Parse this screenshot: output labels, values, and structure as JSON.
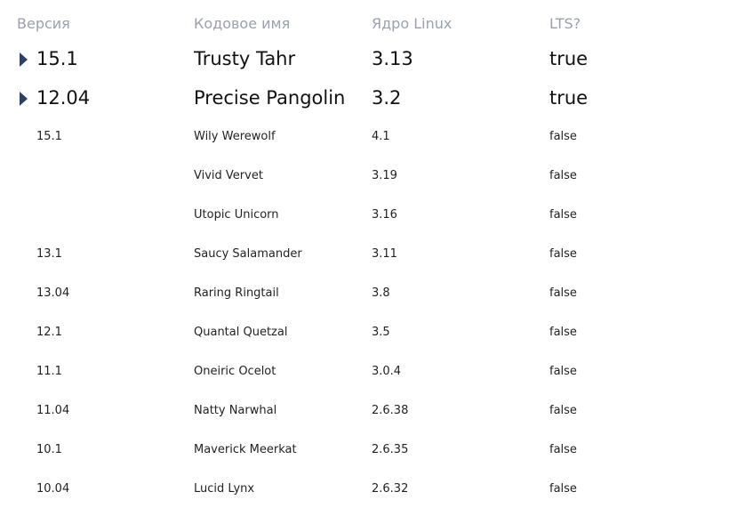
{
  "table": {
    "headers": {
      "version": "Версия",
      "codename": "Кодовое имя",
      "kernel": "Ядро Linux",
      "lts": "LTS?"
    },
    "groups": [
      {
        "version": "15.1",
        "codename": "Trusty Tahr",
        "kernel": "3.13",
        "lts": "true",
        "expand_icon": "triangle-right-icon"
      },
      {
        "version": "12.04",
        "codename": "Precise Pangolin",
        "kernel": "3.2",
        "lts": "true",
        "expand_icon": "triangle-right-icon"
      }
    ],
    "rows": [
      {
        "version": "15.1",
        "codename": "Wily Werewolf",
        "kernel": "4.1",
        "lts": "false"
      },
      {
        "version": "",
        "codename": "Vivid Vervet",
        "kernel": "3.19",
        "lts": "false"
      },
      {
        "version": "",
        "codename": "Utopic Unicorn",
        "kernel": "3.16",
        "lts": "false"
      },
      {
        "version": "13.1",
        "codename": "Saucy Salamander",
        "kernel": "3.11",
        "lts": "false"
      },
      {
        "version": "13.04",
        "codename": "Raring Ringtail",
        "kernel": "3.8",
        "lts": "false"
      },
      {
        "version": "12.1",
        "codename": "Quantal Quetzal",
        "kernel": "3.5",
        "lts": "false"
      },
      {
        "version": "11.1",
        "codename": "Oneiric Ocelot",
        "kernel": "3.0.4",
        "lts": "false"
      },
      {
        "version": "11.04",
        "codename": "Natty Narwhal",
        "kernel": "2.6.38",
        "lts": "false"
      },
      {
        "version": "10.1",
        "codename": "Maverick Meerkat",
        "kernel": "2.6.35",
        "lts": "false"
      },
      {
        "version": "10.04",
        "codename": "Lucid Lynx",
        "kernel": "2.6.32",
        "lts": "false"
      }
    ]
  },
  "colors": {
    "header_text": "#9aa0ae",
    "expander": "#2f4066",
    "text": "#111111"
  }
}
